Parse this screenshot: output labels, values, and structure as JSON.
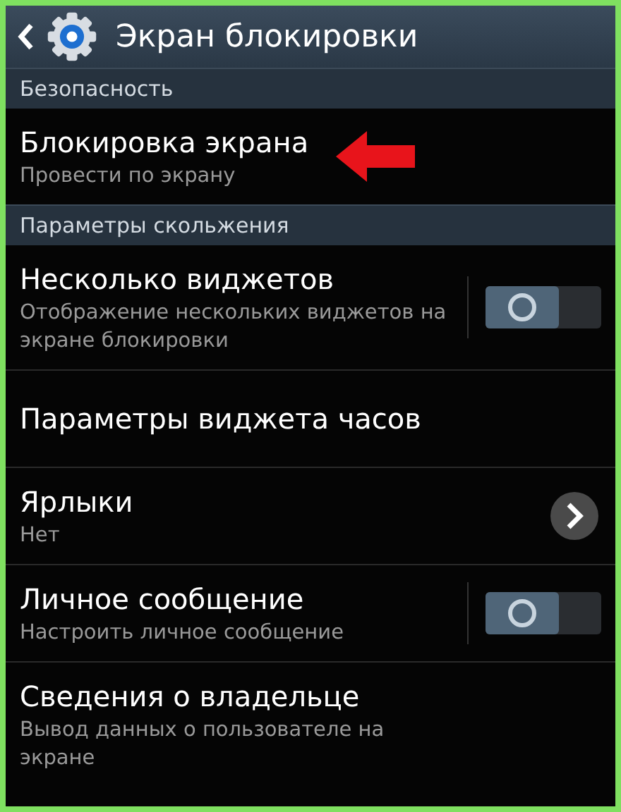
{
  "header": {
    "title": "Экран блокировки"
  },
  "sections": [
    {
      "title": "Безопасность",
      "items": [
        {
          "kind": "plain",
          "title": "Блокировка экрана",
          "subtitle": "Провести по экрану",
          "marked": true
        }
      ]
    },
    {
      "title": "Параметры скольжения",
      "items": [
        {
          "kind": "toggle",
          "title": "Несколько виджетов",
          "subtitle": "Отображение нескольких виджетов на экране блокировки",
          "on": false
        },
        {
          "kind": "plain",
          "title": "Параметры виджета часов"
        },
        {
          "kind": "chevron",
          "title": "Ярлыки",
          "subtitle": "Нет"
        },
        {
          "kind": "toggle",
          "title": "Личное сообщение",
          "subtitle": "Настроить личное сообщение",
          "on": false
        },
        {
          "kind": "plain",
          "title": "Сведения о владельце",
          "subtitle": "Вывод данных о пользователе на экране"
        }
      ]
    }
  ]
}
